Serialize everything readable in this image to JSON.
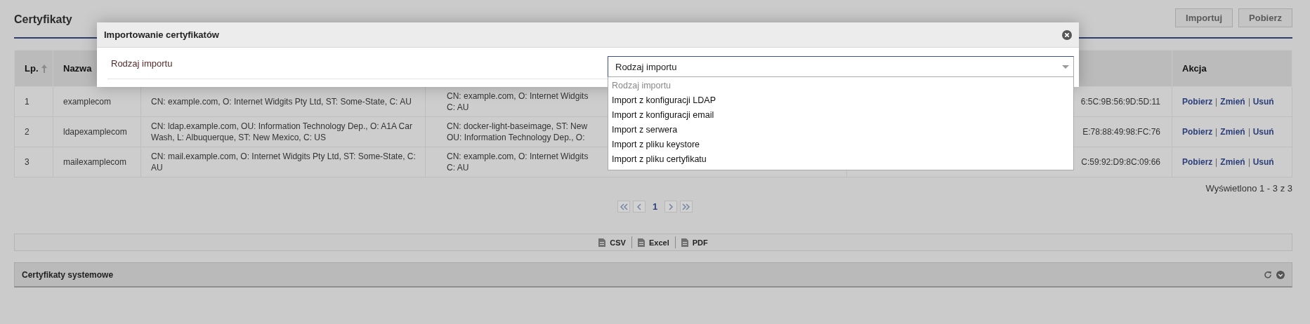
{
  "header": {
    "title": "Certyfikaty",
    "buttons": [
      "Importuj",
      "Pobierz"
    ]
  },
  "table": {
    "headers": {
      "lp": "Lp.",
      "name": "Nazwa",
      "action": "Akcja"
    },
    "rows": [
      {
        "lp": "1",
        "name": "examplecom",
        "column_3": "CN: example.com, O: Internet Widgits Pty Ltd, ST: Some-State, C: AU",
        "column_4": [
          "CN: example.com, O: Internet Widgits",
          "C: AU"
        ],
        "column_5": "6:5C:9B:56:9D:5D:11",
        "actions": [
          "Pobierz",
          "Zmień",
          "Usuń"
        ]
      },
      {
        "lp": "2",
        "name": "ldapexamplecom",
        "column_3": "CN: ldap.example.com, OU: Information Technology Dep., O: A1A Car Wash, L: Albuquerque, ST: New Mexico, C: US",
        "column_4": [
          "CN: docker-light-baseimage, ST: New",
          "OU: Information Technology Dep., O:"
        ],
        "column_5": "E:78:88:49:98:FC:76",
        "actions": [
          "Pobierz",
          "Zmień",
          "Usuń"
        ]
      },
      {
        "lp": "3",
        "name": "mailexamplecom",
        "column_3": "CN: mail.example.com, O: Internet Widgits Pty Ltd, ST: Some-State, C: AU",
        "column_4": [
          "CN: example.com, O: Internet Widgits",
          "C: AU"
        ],
        "column_5": "C:59:92:D9:8C:09:66",
        "actions": [
          "Pobierz",
          "Zmień",
          "Usuń"
        ]
      }
    ],
    "summary": "Wyświetlono 1 - 3 z 3"
  },
  "pagination": {
    "pages": [
      {
        "label": "1",
        "selected": true
      }
    ]
  },
  "export": [
    "CSV",
    "Excel",
    "PDF"
  ],
  "panel": {
    "title": "Certyfikaty systemowe"
  },
  "modal": {
    "title": "Importowanie certyfikatów",
    "field_label": "Rodzaj importu",
    "select": {
      "value": "Rodzaj importu",
      "expanded": true,
      "options": [
        {
          "label": "Rodzaj importu",
          "disabled": true
        },
        {
          "label": "Import z konfiguracji LDAP",
          "disabled": false
        },
        {
          "label": "Import z konfiguracji email",
          "disabled": false
        },
        {
          "label": "Import z serwera",
          "disabled": false
        },
        {
          "label": "Import z pliku keystore",
          "disabled": false
        },
        {
          "label": "Import z pliku certyfikatu",
          "disabled": false
        }
      ]
    }
  }
}
